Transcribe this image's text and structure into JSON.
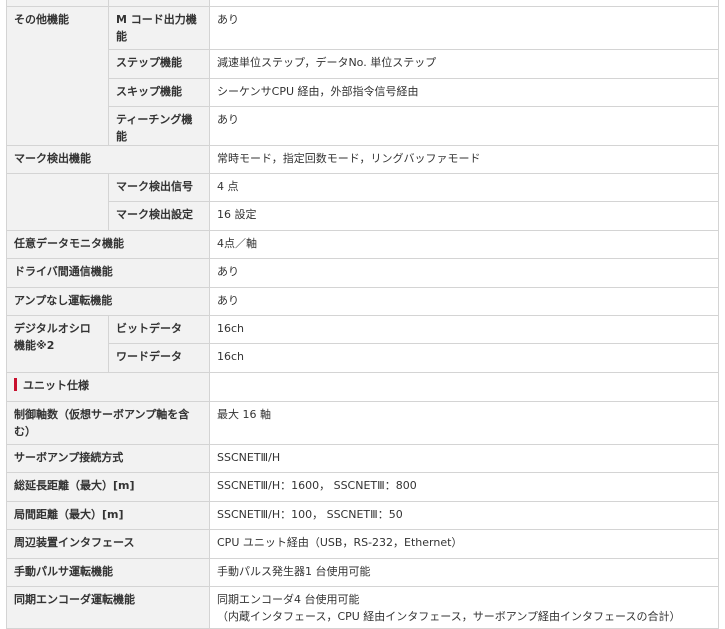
{
  "other": {
    "label": "その他機能",
    "m_code_label": "M コード出力機能",
    "m_code_value": "あり",
    "step_label": "ステップ機能",
    "step_value": "減速単位ステップ，データNo. 単位ステップ",
    "skip_label": "スキップ機能",
    "skip_value": "シーケンサCPU 経由，外部指令信号経由",
    "teaching_label": "ティーチング機能",
    "teaching_value": "あり"
  },
  "mark": {
    "label": "マーク検出機能",
    "value": "常時モード，指定回数モード，リングバッファモード",
    "signal_label": "マーク検出信号",
    "signal_value": "4 点",
    "setting_label": "マーク検出設定",
    "setting_value": "16 設定"
  },
  "monitor": {
    "label": "任意データモニタ機能",
    "value": "4点／軸"
  },
  "driver_comm": {
    "label": "ドライバ間通信機能",
    "value": "あり"
  },
  "ampless": {
    "label": "アンプなし運転機能",
    "value": "あり"
  },
  "oscillo": {
    "label": "デジタルオシロ機能※2",
    "bit_label": "ビットデータ",
    "bit_value": "16ch",
    "word_label": "ワードデータ",
    "word_value": "16ch"
  },
  "unit_section": {
    "label": "ユニット仕様"
  },
  "axes": {
    "label": "制御軸数（仮想サーボアンプ軸を含む）",
    "value": "最大 16 軸"
  },
  "servo_conn": {
    "label": "サーボアンプ接続方式",
    "value": "SSCNETⅢ/H"
  },
  "total_distance": {
    "label": "総延長距離（最大）[m]",
    "value": "SSCNETⅢ/H：1600， SSCNETⅢ：800"
  },
  "station_distance": {
    "label": "局間距離（最大）[m]",
    "value": "SSCNETⅢ/H：100， SSCNETⅢ：50"
  },
  "peripheral": {
    "label": "周辺装置インタフェース",
    "value": "CPU ユニット経由（USB，RS-232，Ethernet）"
  },
  "manual_pulser": {
    "label": "手動パルサ運転機能",
    "value": "手動パルス発生器1 台使用可能"
  },
  "sync_encoder": {
    "label": "同期エンコーダ運転機能",
    "value_line1": "同期エンコーダ4 台使用可能",
    "value_line2": "（内蔵インタフェース，CPU 経由インタフェース，サーボアンプ経由インタフェースの合計）"
  },
  "colors": {
    "header_bg": "#f2f2f2",
    "border": "#d4d4d4",
    "section_marker": "#c8102e"
  }
}
